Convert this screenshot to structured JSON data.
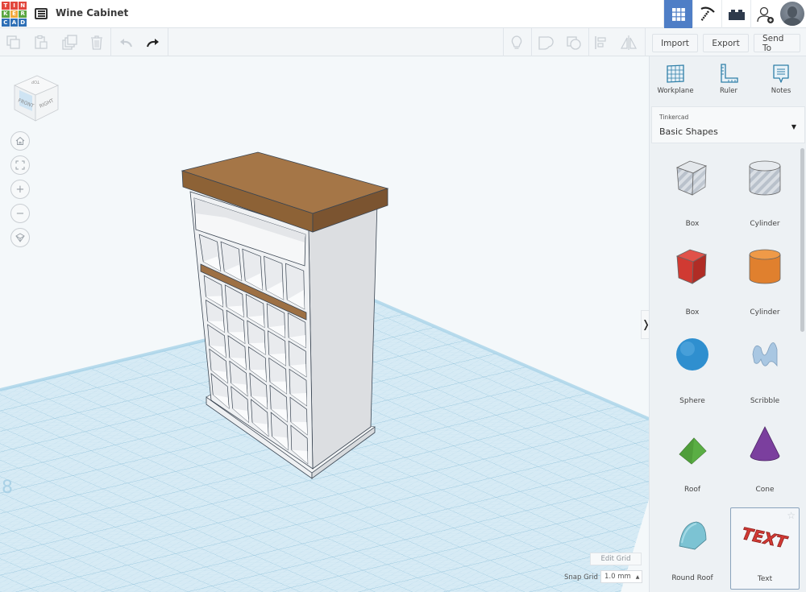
{
  "header": {
    "logo_letters": [
      "T",
      "I",
      "N",
      "K",
      "E",
      "R",
      "C",
      "A",
      "D"
    ],
    "logo_colors": [
      "#e2463c",
      "#e2463c",
      "#e2463c",
      "#5aa541",
      "#f2a93b",
      "#5aa541",
      "#2e6fb6",
      "#2e6fb6",
      "#2e6fb6"
    ],
    "design_list_icon": "list-icon",
    "title": "Wine Cabinet",
    "right_buttons": [
      {
        "name": "3d-design-view",
        "icon": "grid-icon",
        "active": true
      },
      {
        "name": "codeblocks-view",
        "icon": "pickaxe-icon",
        "active": false
      },
      {
        "name": "bricks-view",
        "icon": "brick-icon",
        "active": false
      },
      {
        "name": "invite-user",
        "icon": "add-user-icon",
        "active": false
      }
    ],
    "accent_color": "#4f7ec6"
  },
  "toolbar": {
    "left_tools": [
      {
        "name": "copy",
        "icon": "copy-icon",
        "enabled": false
      },
      {
        "name": "paste",
        "icon": "paste-icon",
        "enabled": false
      },
      {
        "name": "duplicate",
        "icon": "duplicate-icon",
        "enabled": false
      },
      {
        "name": "delete",
        "icon": "trash-icon",
        "enabled": false
      },
      {
        "name": "undo",
        "icon": "undo-icon",
        "enabled": false
      },
      {
        "name": "redo",
        "icon": "redo-icon",
        "enabled": true
      }
    ],
    "right_tools": [
      {
        "name": "show-all",
        "icon": "lightbulb-icon"
      },
      {
        "name": "group",
        "icon": "group-icon"
      },
      {
        "name": "ungroup",
        "icon": "ungroup-icon"
      },
      {
        "name": "align",
        "icon": "align-icon"
      },
      {
        "name": "mirror",
        "icon": "mirror-icon"
      }
    ],
    "import_label": "Import",
    "export_label": "Export",
    "send_to_label": "Send To"
  },
  "viewport": {
    "viewcube": {
      "top": "TOP",
      "front": "FRONT",
      "right": "RIGHT"
    },
    "nav_buttons": [
      {
        "name": "home-view",
        "icon": "home-icon"
      },
      {
        "name": "fit-all",
        "icon": "fit-icon"
      },
      {
        "name": "zoom-in",
        "icon": "plus-icon",
        "glyph": "+"
      },
      {
        "name": "zoom-out",
        "icon": "minus-icon",
        "glyph": "−"
      },
      {
        "name": "ortho-perspective",
        "icon": "perspective-icon"
      }
    ],
    "edit_grid_label": "Edit Grid",
    "snap_grid_label": "Snap Grid",
    "snap_grid_value": "1.0 mm",
    "snap_caret": "▲",
    "collapse_glyph": "❭",
    "model": {
      "name": "Wine Cabinet",
      "top_color": "#a57647",
      "body_color": "#eef0f2",
      "side_color": "#dadcdf",
      "rack_columns": 5,
      "rack_rows_lower": 5,
      "rack_rows_upper": 1
    },
    "workplane_color": "#cfe6f2"
  },
  "panel": {
    "tools": [
      {
        "name": "workplane",
        "label": "Workplane",
        "icon": "workplane-icon"
      },
      {
        "name": "ruler",
        "label": "Ruler",
        "icon": "ruler-icon"
      },
      {
        "name": "notes",
        "label": "Notes",
        "icon": "notes-icon"
      }
    ],
    "library": {
      "source": "Tinkercad",
      "category": "Basic Shapes",
      "caret": "▼"
    },
    "shapes": [
      {
        "label": "Box",
        "kind": "box-hole",
        "color": "#c9d0d8"
      },
      {
        "label": "Cylinder",
        "kind": "cylinder-hole",
        "color": "#c9d0d8"
      },
      {
        "label": "Box",
        "kind": "box",
        "color": "#d03a32"
      },
      {
        "label": "Cylinder",
        "kind": "cylinder",
        "color": "#e0802e"
      },
      {
        "label": "Sphere",
        "kind": "sphere",
        "color": "#2f8fcf"
      },
      {
        "label": "Scribble",
        "kind": "scribble",
        "color": "#a9c7e2"
      },
      {
        "label": "Roof",
        "kind": "roof",
        "color": "#4f9e3a"
      },
      {
        "label": "Cone",
        "kind": "cone",
        "color": "#7b3f9e"
      },
      {
        "label": "Round Roof",
        "kind": "round-roof",
        "color": "#7cc3d3"
      },
      {
        "label": "Text",
        "kind": "text",
        "color": "#d23a35",
        "selected": true,
        "favorite_icon": "☆"
      }
    ]
  }
}
